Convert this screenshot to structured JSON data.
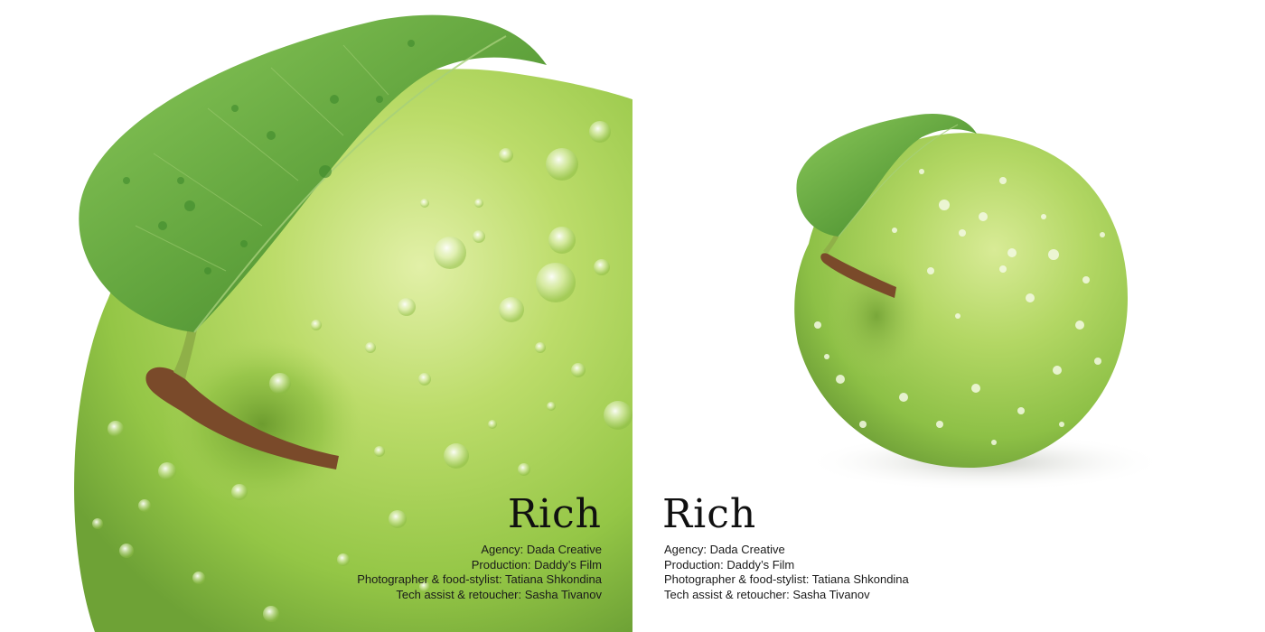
{
  "panels": [
    {
      "id": "closeup",
      "title": "Rich",
      "credits": [
        "Agency: Dada Creative",
        "Production: Daddy’s Film",
        "Photographer & food-stylist: Tatiana Shkondina",
        "Tech assist & retoucher: Sasha Tivanov"
      ]
    },
    {
      "id": "whole",
      "title": "Rich",
      "credits": [
        "Agency: Dada Creative",
        "Production: Daddy’s Film",
        "Photographer & food-stylist: Tatiana Shkondina",
        "Tech assist & retoucher: Sasha Tivanov"
      ]
    }
  ],
  "colors": {
    "apple_light": "#c8e27a",
    "apple_mid": "#9ccc4a",
    "apple_dark": "#6fa535",
    "leaf_light": "#7cbf4f",
    "leaf_dark": "#3d7f2a",
    "stem": "#7a4a2a",
    "text": "#101010",
    "background": "#ffffff"
  },
  "image_subject": [
    "green-apple-closeup-with-leaf",
    "green-apple-whole-with-leaf"
  ]
}
